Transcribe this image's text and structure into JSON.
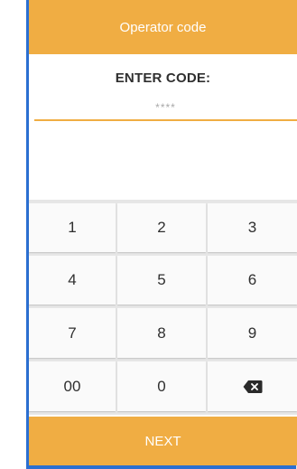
{
  "header": {
    "title": "Operator code"
  },
  "prompt": {
    "label": "ENTER CODE:"
  },
  "code_field": {
    "value": "",
    "placeholder": "****"
  },
  "keypad": {
    "keys": [
      {
        "label": "1"
      },
      {
        "label": "2"
      },
      {
        "label": "3"
      },
      {
        "label": "4"
      },
      {
        "label": "5"
      },
      {
        "label": "6"
      },
      {
        "label": "7"
      },
      {
        "label": "8"
      },
      {
        "label": "9"
      },
      {
        "label": "00"
      },
      {
        "label": "0"
      },
      {
        "icon": "backspace-icon"
      }
    ]
  },
  "footer": {
    "next_label": "NEXT"
  },
  "colors": {
    "accent": "#f0ad43",
    "window_border": "#2b6fd1",
    "key_bg": "#fafafa",
    "keypad_bg": "#e6e6e6"
  }
}
